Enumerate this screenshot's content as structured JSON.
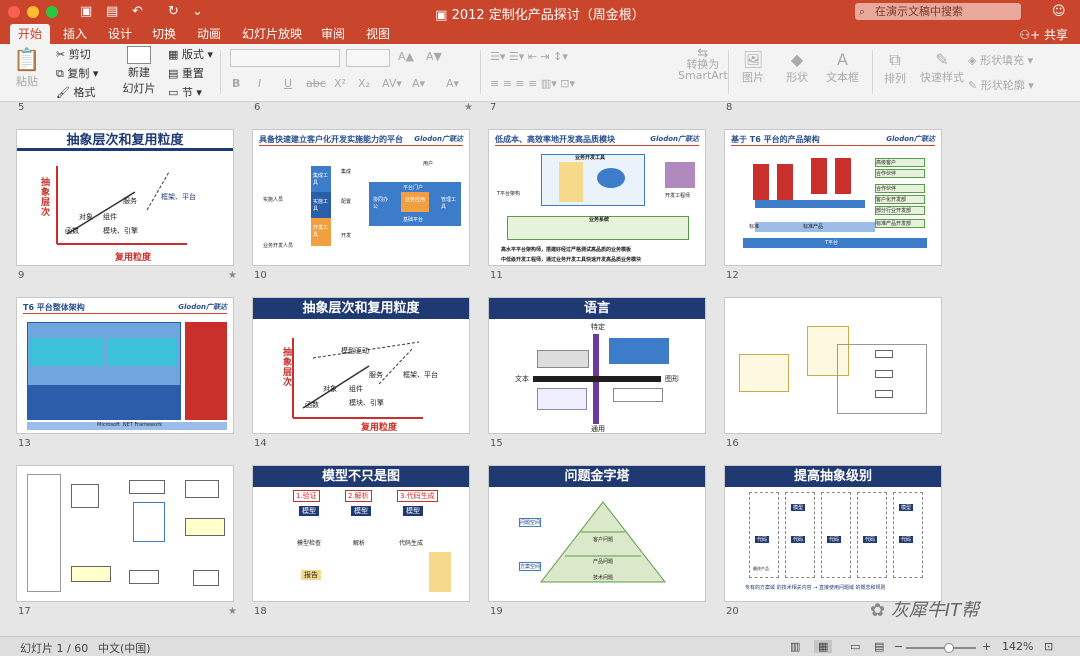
{
  "window": {
    "title": "2012 定制化产品探讨（周金根）",
    "search_placeholder": "在演示文稿中搜索",
    "share": "共享"
  },
  "tabs": [
    {
      "label": "开始",
      "active": true
    },
    {
      "label": "插入"
    },
    {
      "label": "设计"
    },
    {
      "label": "切换"
    },
    {
      "label": "动画"
    },
    {
      "label": "幻灯片放映"
    },
    {
      "label": "审阅"
    },
    {
      "label": "视图"
    }
  ],
  "ribbon": {
    "paste": "粘贴",
    "cut": "剪切",
    "copy": "复制",
    "format": "格式",
    "new_slide": "新建\n幻灯片",
    "layout": "版式",
    "reset": "重置",
    "section": "节",
    "convert": "转换为",
    "smartart": "SmartArt",
    "picture": "图片",
    "shape": "形状",
    "textbox": "文本框",
    "arrange": "排列",
    "quick_style": "快速样式",
    "shape_fill": "形状填充",
    "shape_outline": "形状轮廓"
  },
  "top_row": [
    {
      "n": "5"
    },
    {
      "n": "6"
    },
    {
      "n": "7"
    },
    {
      "n": "8"
    }
  ],
  "slides": [
    {
      "n": "9",
      "title": "抽象层次和复用粒度",
      "ylabel": "抽象层次",
      "xlabel": "复用粒度",
      "l1": "函数",
      "l2": "对象",
      "l3": "组件",
      "l4": "服务",
      "l5": "框架、平台",
      "l6": "模块、引擎"
    },
    {
      "n": "10",
      "title": "具备快速建立客户化开发实施能力的平台",
      "logo": "Glodon广联达",
      "a": "集成工具",
      "b": "实施工具",
      "c": "开发工具",
      "d": "平台门户",
      "e": "业务应用",
      "f": "基础平台",
      "g": "实施人员",
      "h": "业务开发人员",
      "i": "用户",
      "j": "集成",
      "k": "配置",
      "l": "开发",
      "m": "协同办公",
      "n2": "管理工具"
    },
    {
      "n": "11",
      "title": "低成本、高效率地开发高品质模块",
      "logo": "Glodon广联达",
      "a": "业务开发工具",
      "b": "业务系统",
      "c": "T平台架构",
      "d": "开发工程师",
      "p1": "高水平平台架构师，搭建好经过严格测试高品质的业务模板",
      "p2": "中低级开发工程师，通过业务开发工具快速开发高品质业务模块"
    },
    {
      "n": "12",
      "title": "基于 T6 平台的产品架构",
      "logo": "Glodon广联达",
      "a": "高级客户",
      "b": "合作伙伴",
      "c": "合作伙伴",
      "d": "客户化开发部",
      "e": "部分行业开发部",
      "f": "标准产品开发部",
      "g": "标准产品",
      "h": "T平台",
      "i": "标准"
    },
    {
      "n": "13",
      "title": "T6 平台整体架构",
      "logo": "Glodon广联达",
      "foot": "Microsoft .NET Framework"
    },
    {
      "n": "14",
      "title": "抽象层次和复用粒度",
      "ylabel": "抽象层次",
      "xlabel": "复用粒度",
      "l1": "函数",
      "l2": "对象",
      "l3": "组件",
      "l4": "服务",
      "l5": "框架、平台",
      "l6": "模块、引擎",
      "l7": "模型驱动"
    },
    {
      "n": "15",
      "title": "语言",
      "top": "特定",
      "bottom": "通用",
      "left": "文本",
      "right": "图形"
    },
    {
      "n": "16"
    },
    {
      "n": "17"
    },
    {
      "n": "18",
      "title": "模型不只是图",
      "s1": "1.验证",
      "s2": "2.解析",
      "s3": "3.代码生成",
      "m": "模型",
      "c1": "模型检查",
      "c2": "解析",
      "c3": "代码生成",
      "r": "报告"
    },
    {
      "n": "19",
      "title": "问题金字塔",
      "a": "问题空间",
      "b": "方案空间",
      "c": "客户问题",
      "d": "产品问题",
      "e": "技术问题"
    },
    {
      "n": "20",
      "title": "提高抽象级别",
      "m": "模型",
      "c": "代码",
      "p": "最终产品",
      "foot": "专有的方案域 的技术相关内容 → 直接使用问题域 的概念和规则"
    }
  ],
  "watermark": "灰犀牛IT帮",
  "status": {
    "slide": "幻灯片 1 / 60",
    "lang": "中文(中国)",
    "zoom": "142%"
  }
}
